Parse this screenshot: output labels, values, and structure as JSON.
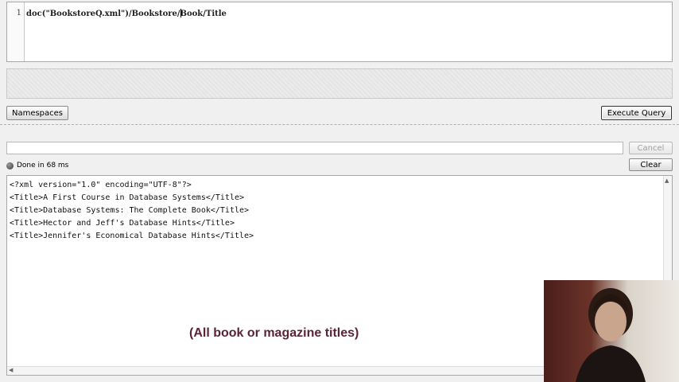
{
  "editor": {
    "line_number": "1",
    "query_before_cursor": "doc(\"BookstoreQ.xml\")/Bookstore/",
    "query_after_cursor": "Book/Title"
  },
  "toolbar": {
    "namespaces_label": "Namespaces",
    "execute_label": "Execute Query"
  },
  "progress": {
    "cancel_label": "Cancel"
  },
  "status": {
    "text": "Done in 68 ms",
    "clear_label": "Clear"
  },
  "results": {
    "lines": [
      "<?xml version=\"1.0\" encoding=\"UTF-8\"?>",
      "<Title>A First Course in Database Systems</Title>",
      "<Title>Database Systems: The Complete Book</Title>",
      "<Title>Hector and Jeff's Database Hints</Title>",
      "<Title>Jennifer's Economical Database Hints</Title>"
    ]
  },
  "overlay": {
    "caption": "(All book or magazine titles)"
  },
  "icons": {
    "status": "status-dot-icon",
    "scroll_up": "arrow-up-icon",
    "scroll_down": "arrow-down-icon",
    "scroll_left": "arrow-left-icon",
    "scroll_right": "arrow-right-icon"
  },
  "colors": {
    "caption": "#5a2436",
    "background": "#f0f0f0"
  }
}
